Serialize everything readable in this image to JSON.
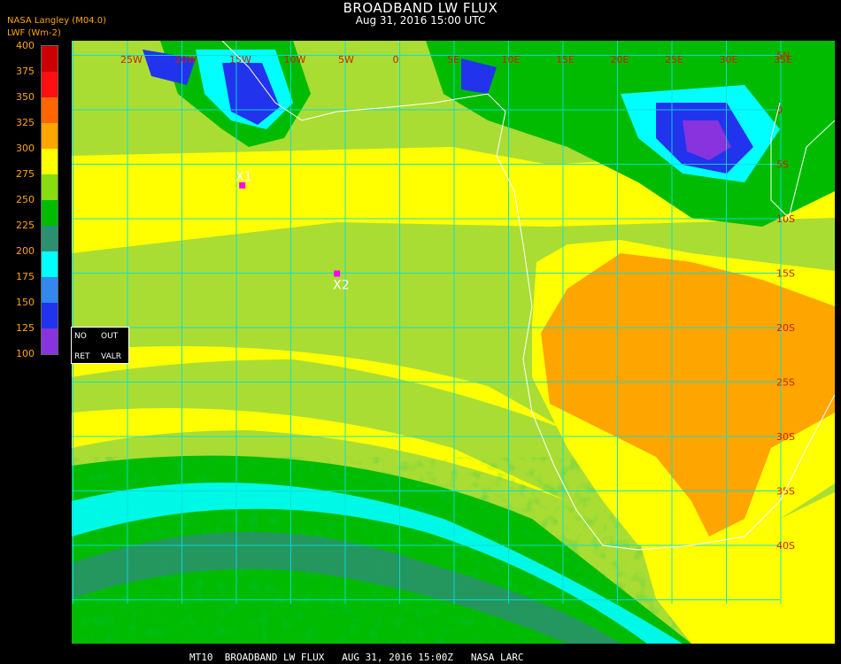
{
  "title": "BROADBAND LW FLUX",
  "subtitle": "Aug 31, 2016 15:00 UTC",
  "source": "NASA Langley (M04.0)",
  "units": "LWF (Wm-2)",
  "colorbar": {
    "ticks": [
      "100",
      "125",
      "150",
      "175",
      "200",
      "225",
      "250",
      "275",
      "300",
      "325",
      "350",
      "375",
      "400"
    ],
    "colors": [
      "#8833dd",
      "#2233ee",
      "#3388ee",
      "#00ffff",
      "#2a9070",
      "#00bb00",
      "#88dd11",
      "#ffff00",
      "#ffa500",
      "#ff6600",
      "#ff1010",
      "#cc0000"
    ]
  },
  "box": {
    "no": "NO",
    "out": "OUT",
    "ret": "RET",
    "valr": "VALR"
  },
  "lon_labels": [
    "25W",
    "20W",
    "15W",
    "10W",
    "5W",
    "0",
    "5E",
    "10E",
    "15E",
    "20E",
    "25E",
    "30E",
    "35E"
  ],
  "lat_labels": [
    "5N",
    "0",
    "5S",
    "10S",
    "15S",
    "20S",
    "25S",
    "30S",
    "35S",
    "40S"
  ],
  "points": [
    {
      "label": "X1",
      "lat": -6.9,
      "lon": -14.5
    },
    {
      "label": "X2",
      "lat": -15.0,
      "lon": -5.8
    }
  ],
  "marker_color": "#ff00ff",
  "footer": "MT10  BROADBAND LW FLUX   AUG 31, 2016 15:00Z   NASA LARC"
}
